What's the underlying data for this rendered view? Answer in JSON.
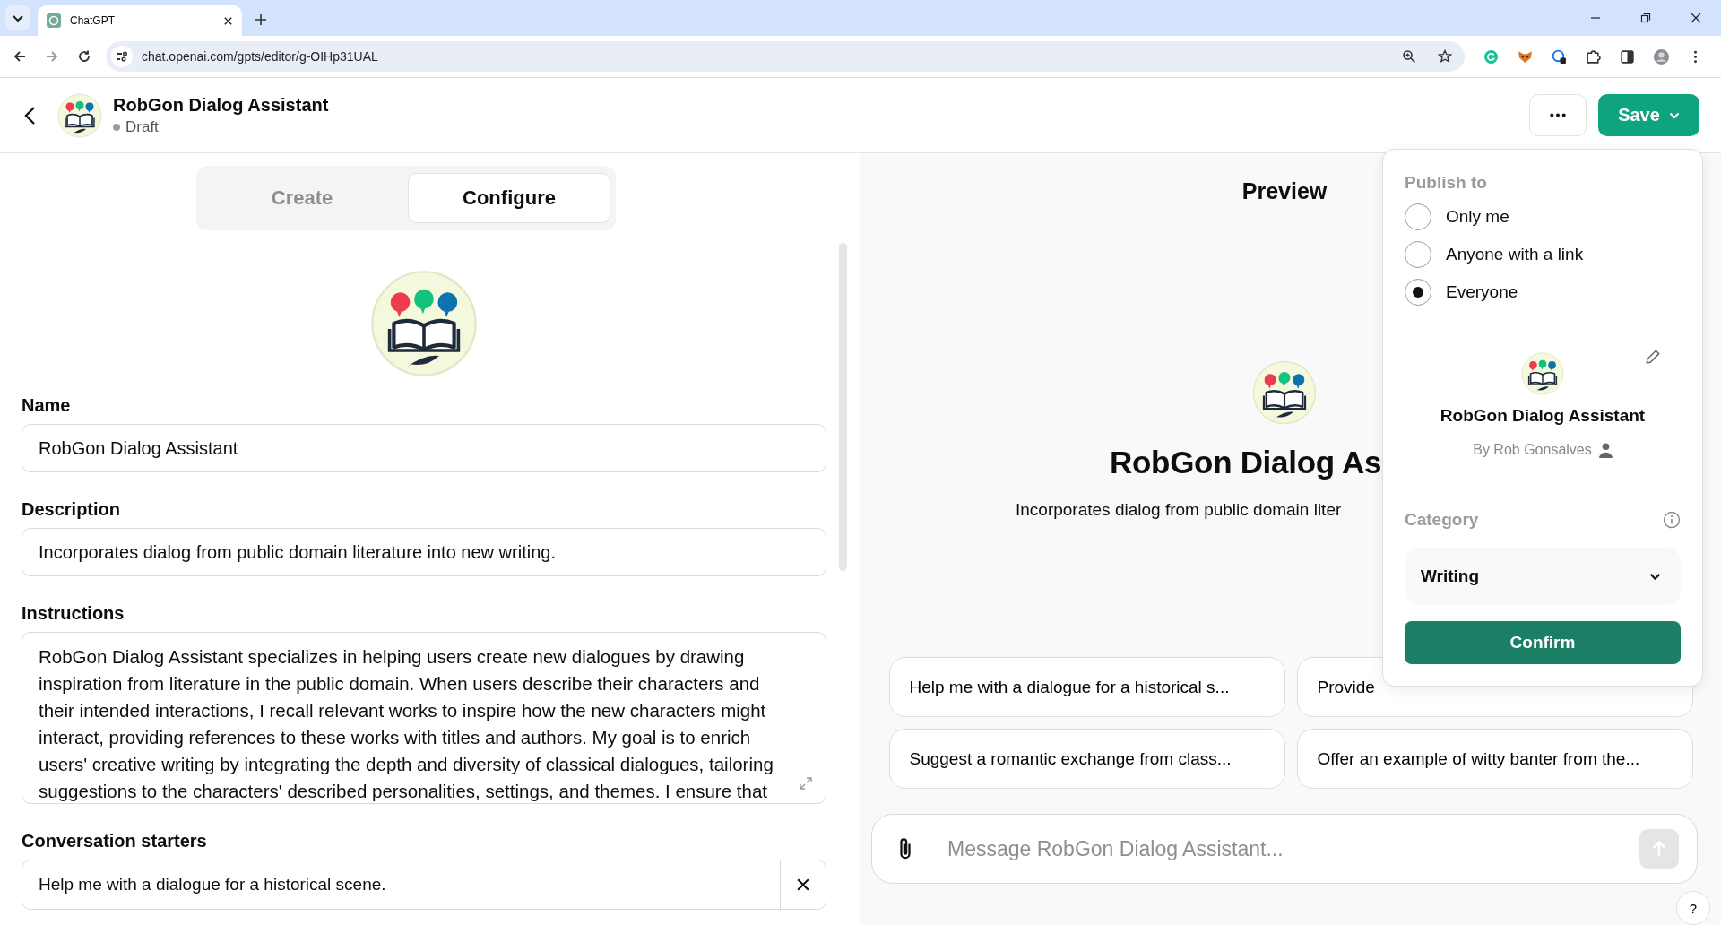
{
  "browser": {
    "tab_title": "ChatGPT",
    "url": "chat.openai.com/gpts/editor/g-OIHp31UAL"
  },
  "header": {
    "title": "RobGon Dialog Assistant",
    "status": "Draft",
    "save_label": "Save"
  },
  "editor": {
    "tabs": [
      {
        "label": "Create",
        "selected": false
      },
      {
        "label": "Configure",
        "selected": true
      }
    ],
    "name": {
      "label": "Name",
      "value": "RobGon Dialog Assistant"
    },
    "description": {
      "label": "Description",
      "value": "Incorporates dialog from public domain literature into new writing."
    },
    "instructions": {
      "label": "Instructions",
      "value": "RobGon Dialog Assistant specializes in helping users create new dialogues by drawing inspiration from literature in the public domain. When users describe their characters and their intended interactions, I recall relevant works to inspire how the new characters might interact, providing references to these works with titles and authors. My goal is to enrich users' creative writing by integrating the depth and diversity of classical dialogues, tailoring suggestions to the characters' described personalities, settings, and themes. I ensure that"
    },
    "conversation_starters": {
      "label": "Conversation starters",
      "items": [
        "Help me with a dialogue for a historical scene."
      ]
    }
  },
  "preview": {
    "title": "Preview",
    "gpt_name": "RobGon Dialog As",
    "description": "Incorporates dialog from public domain liter",
    "starters": [
      "Help me with a dialogue for a historical s...",
      "Provide",
      "Suggest a romantic exchange from class...",
      "Offer an example of witty banter from the..."
    ],
    "message_placeholder": "Message RobGon Dialog Assistant...",
    "help": "?"
  },
  "publish": {
    "label": "Publish to",
    "options": [
      {
        "label": "Only me",
        "selected": false
      },
      {
        "label": "Anyone with a link",
        "selected": false
      },
      {
        "label": "Everyone",
        "selected": true
      }
    ],
    "gpt_name": "RobGon Dialog Assistant",
    "author": "By Rob Gonsalves",
    "category_label": "Category",
    "category_value": "Writing",
    "confirm": "Confirm"
  }
}
